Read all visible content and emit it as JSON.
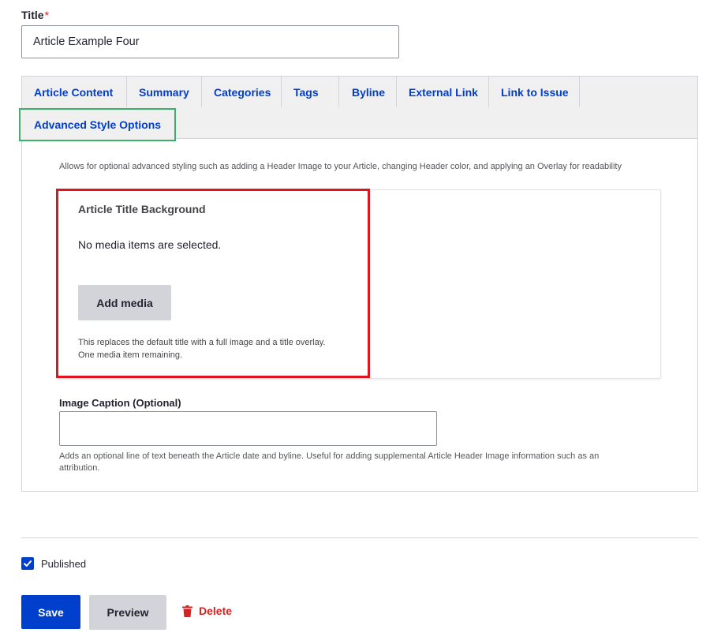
{
  "title_field": {
    "label": "Title",
    "required_mark": "*",
    "value": "Article Example Four"
  },
  "tabs": [
    {
      "label": "Article Content"
    },
    {
      "label": "Summary"
    },
    {
      "label": "Categories"
    },
    {
      "label": "Tags"
    },
    {
      "label": "Byline"
    },
    {
      "label": "External Link"
    },
    {
      "label": "Link to Issue"
    },
    {
      "label": "Advanced Style Options",
      "active": true
    }
  ],
  "advanced": {
    "description": "Allows for optional advanced styling such as adding a Header Image to your Article, changing Header color, and applying an Overlay for readability",
    "media": {
      "title": "Article Title Background",
      "empty_text": "No media items are selected.",
      "add_button": "Add media",
      "help_line1": "This replaces the default title with a full image and a title overlay.",
      "help_line2": "One media item remaining."
    },
    "caption": {
      "label": "Image Caption (Optional)",
      "value": "",
      "help": "Adds an optional line of text beneath the Article date and byline. Useful for adding supplemental Article Header Image information such as an attribution."
    }
  },
  "published": {
    "label": "Published",
    "checked": true
  },
  "actions": {
    "save": "Save",
    "preview": "Preview",
    "delete": "Delete",
    "delete_icon": "trash-icon"
  },
  "colors": {
    "primary": "#003ecc",
    "active_tab_border": "#3bb06a",
    "highlight_border": "#e1141e",
    "danger": "#d72222"
  }
}
